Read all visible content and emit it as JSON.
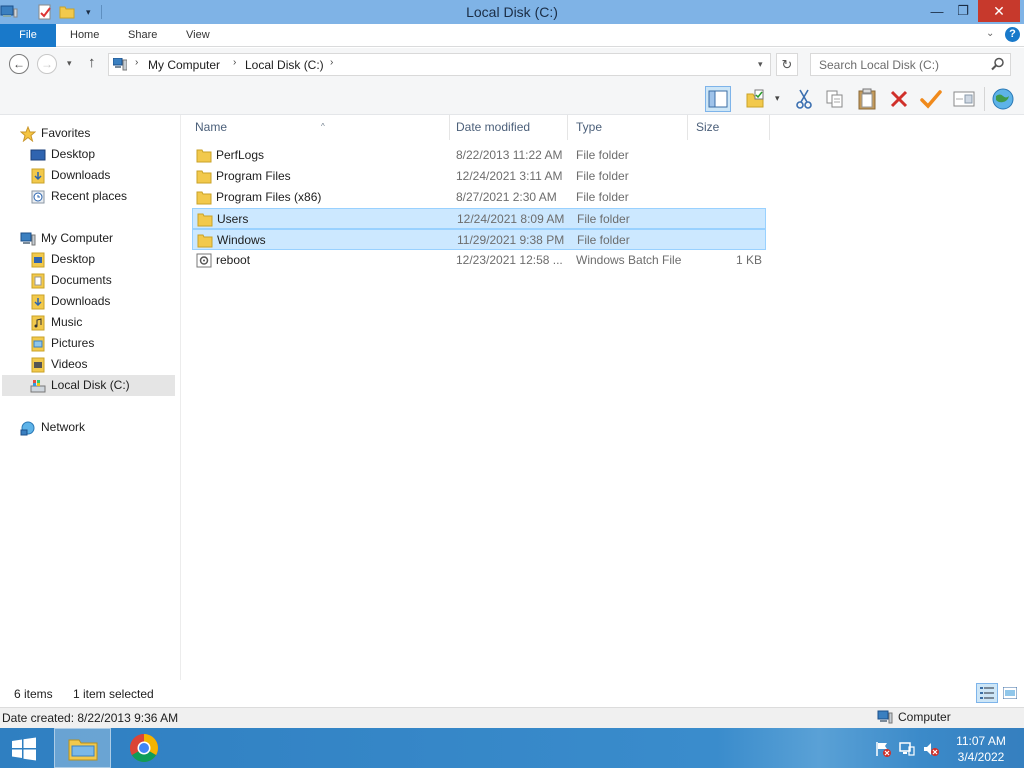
{
  "window": {
    "title": "Local Disk (C:)",
    "controls": {
      "minimize": "—",
      "maximize": "❐",
      "close": "✕"
    }
  },
  "ribbon": {
    "tabs": [
      "File",
      "Home",
      "Share",
      "View"
    ],
    "expand_glyph": "⌄",
    "help_glyph": "?"
  },
  "nav": {
    "back_glyph": "←",
    "forward_glyph": "→",
    "recent_glyph": "▾",
    "up_glyph": "↑",
    "breadcrumb": [
      "My Computer",
      "Local Disk (C:)"
    ],
    "breadcrumb_sep": "›",
    "refresh_glyph": "↻",
    "search_placeholder": "Search Local Disk (C:)"
  },
  "sidebar": {
    "favorites": {
      "label": "Favorites",
      "items": [
        "Desktop",
        "Downloads",
        "Recent places"
      ]
    },
    "computer": {
      "label": "My Computer",
      "items": [
        "Desktop",
        "Documents",
        "Downloads",
        "Music",
        "Pictures",
        "Videos",
        "Local Disk (C:)"
      ]
    },
    "network": {
      "label": "Network"
    }
  },
  "columns": {
    "name": "Name",
    "date": "Date modified",
    "type": "Type",
    "size": "Size"
  },
  "files": [
    {
      "name": "PerfLogs",
      "date": "8/22/2013 11:22 AM",
      "type": "File folder",
      "size": "",
      "kind": "folder-icon"
    },
    {
      "name": "Program Files",
      "date": "12/24/2021 3:11 AM",
      "type": "File folder",
      "size": "",
      "kind": "folder-icon"
    },
    {
      "name": "Program Files (x86)",
      "date": "8/27/2021 2:30 AM",
      "type": "File folder",
      "size": "",
      "kind": "folder-icon"
    },
    {
      "name": "Users",
      "date": "12/24/2021 8:09 AM",
      "type": "File folder",
      "size": "",
      "kind": "folder-icon"
    },
    {
      "name": "Windows",
      "date": "11/29/2021 9:38 PM",
      "type": "File folder",
      "size": "",
      "kind": "folder-icon"
    },
    {
      "name": "reboot",
      "date": "12/23/2021 12:58 ...",
      "type": "Windows Batch File",
      "size": "1 KB",
      "kind": "batch-file-icon"
    }
  ],
  "status": {
    "item_count": "6 items",
    "selection": "1 item selected",
    "date_created": "Date created: 8/22/2013 9:36 AM",
    "location": "Computer"
  },
  "taskbar": {
    "time": "11:07 AM",
    "date": "3/4/2022"
  },
  "colors": {
    "title_bar": "#7fb3e6",
    "file_tab": "#1979ca",
    "close_button": "#c7392c",
    "selection": "#cce8ff",
    "taskbar": "#2f7fc1"
  }
}
